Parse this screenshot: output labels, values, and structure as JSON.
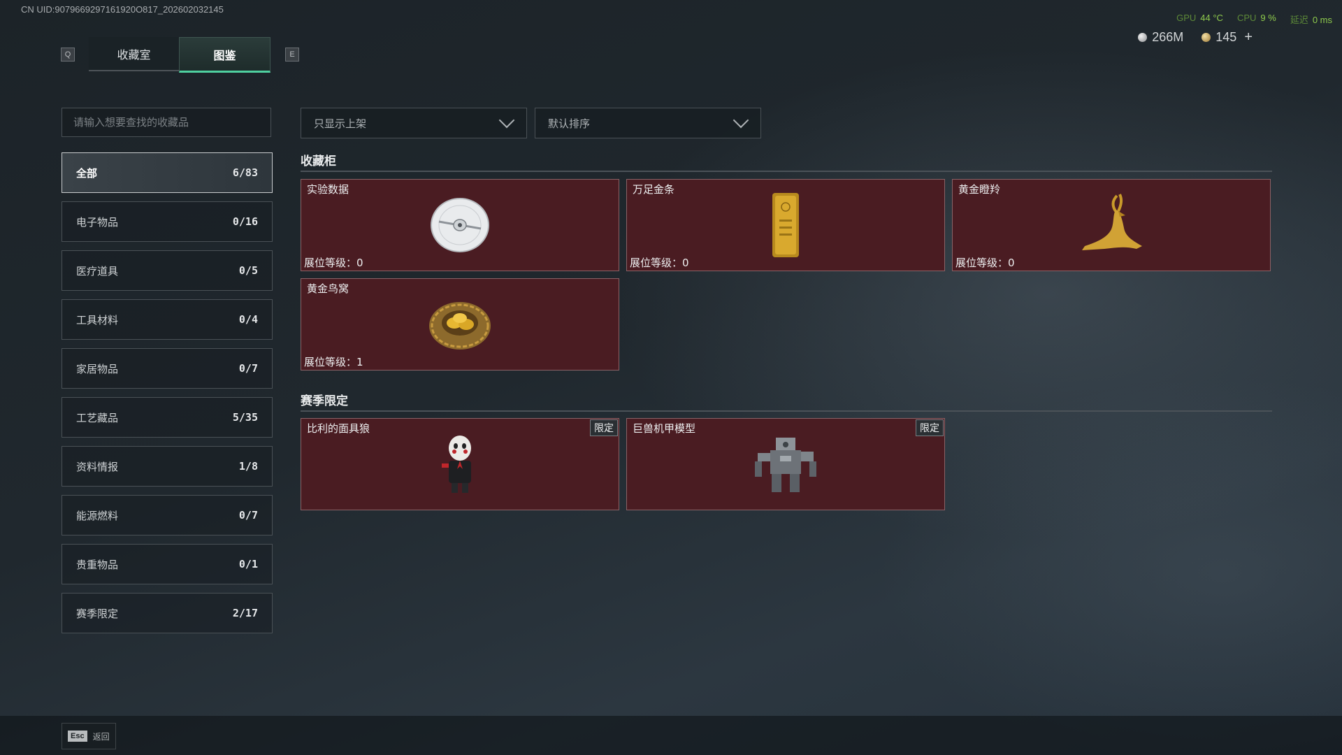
{
  "uid_text": "CN UID:9079669297161920O817_202602032145",
  "hud": {
    "gpu_label": "GPU",
    "gpu_value": "44 °C",
    "cpu_label": "CPU",
    "cpu_value": "9 %",
    "latency_label": "延迟",
    "latency_value": "0 ms"
  },
  "currency": {
    "silver": "266M",
    "gold": "145",
    "add": "+"
  },
  "keys": {
    "left": "Q",
    "right": "E"
  },
  "tabs": [
    {
      "label": "收藏室",
      "active": false
    },
    {
      "label": "图鉴",
      "active": true
    }
  ],
  "search": {
    "placeholder": "请输入想要查找的收藏品",
    "value": ""
  },
  "filters": {
    "show": "只显示上架",
    "sort": "默认排序"
  },
  "categories": [
    {
      "label": "全部",
      "count": "6/83",
      "active": true
    },
    {
      "label": "电子物品",
      "count": "0/16"
    },
    {
      "label": "医疗道具",
      "count": "0/5"
    },
    {
      "label": "工具材料",
      "count": "0/4"
    },
    {
      "label": "家居物品",
      "count": "0/7"
    },
    {
      "label": "工艺藏品",
      "count": "5/35"
    },
    {
      "label": "资料情报",
      "count": "1/8"
    },
    {
      "label": "能源燃料",
      "count": "0/7"
    },
    {
      "label": "贵重物品",
      "count": "0/1"
    },
    {
      "label": "赛季限定",
      "count": "2/17"
    }
  ],
  "sections": {
    "cabinet": {
      "title": "收藏柜",
      "items": [
        {
          "name": "实验数据",
          "level": "展位等级：0",
          "icon": "disc-icon"
        },
        {
          "name": "万足金条",
          "level": "展位等级：0",
          "icon": "gold-bar-icon"
        },
        {
          "name": "黄金瞪羚",
          "level": "展位等级：0",
          "icon": "gold-gazelle-icon"
        },
        {
          "name": "黄金鸟窝",
          "level": "展位等级：1",
          "icon": "gold-nest-icon"
        }
      ]
    },
    "season": {
      "title": "赛季限定",
      "items": [
        {
          "name": "比利的面具狼",
          "badge": "限定",
          "icon": "puppet-icon"
        },
        {
          "name": "巨兽机甲模型",
          "badge": "限定",
          "icon": "mech-icon"
        }
      ]
    }
  },
  "footer": {
    "esc_key": "Esc",
    "esc_label": "返回"
  }
}
